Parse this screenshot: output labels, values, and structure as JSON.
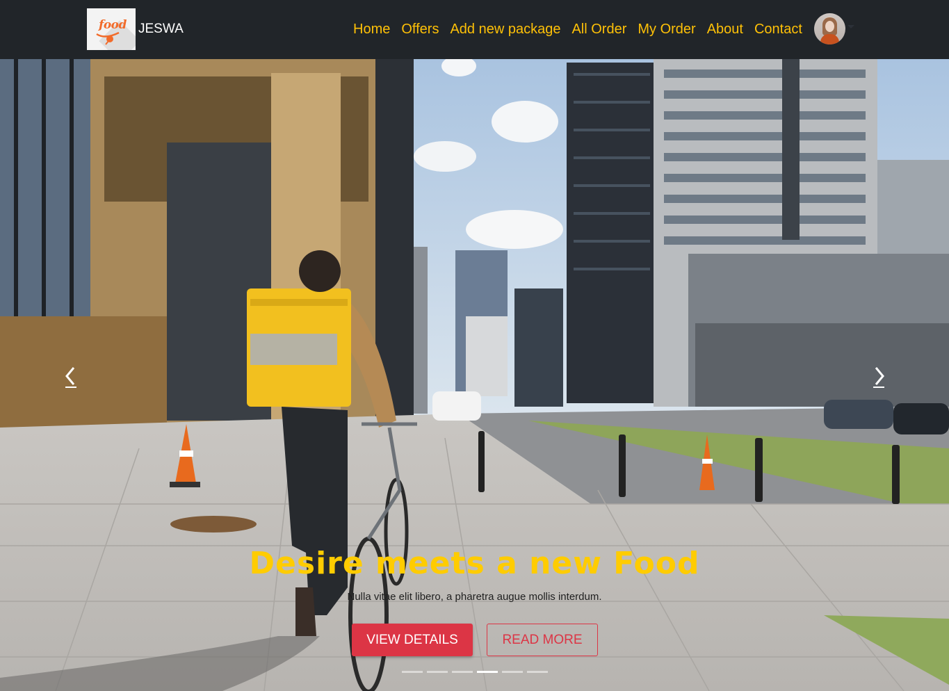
{
  "brand": {
    "logo_text": "food",
    "name": "JESWA",
    "icon": "food-logo"
  },
  "nav": {
    "links": [
      "Home",
      "Offers",
      "Add new package",
      "All Order",
      "My Order",
      "About",
      "Contact"
    ],
    "avatar_icon": "user-avatar",
    "dropdown_icon": "caret-down-icon"
  },
  "carousel": {
    "title": "Desire meets a new Food",
    "text": "Nulla vitae elit libero, a pharetra augue mollis interdum.",
    "primary_button": "VIEW DETAILS",
    "secondary_button": "READ MORE",
    "indicator_count": 6,
    "active_indicator": 4,
    "prev_icon": "chevron-left-icon",
    "next_icon": "chevron-right-icon"
  },
  "colors": {
    "navbar_bg": "#212529",
    "nav_link": "#ffc107",
    "caption_title": "#ffcc00",
    "accent_red": "#dc3545"
  }
}
